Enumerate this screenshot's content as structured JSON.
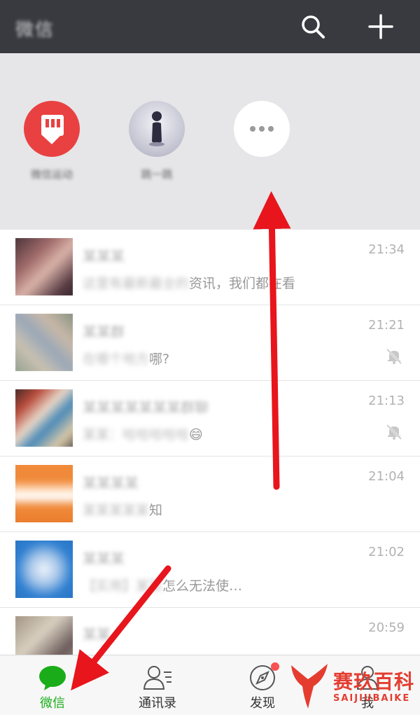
{
  "topbar": {
    "title": "微信",
    "search_icon": "search-icon",
    "add_icon": "plus-icon",
    "bg_color": "#393a3f"
  },
  "mini_programs": [
    {
      "label": "微信运动",
      "icon": "fist-app-icon",
      "color": "#e94141"
    },
    {
      "label": "跳一跳",
      "icon": "jump-game-icon"
    },
    {
      "label": "",
      "icon": "more-icon"
    }
  ],
  "chats": [
    {
      "name": "某某某",
      "preview_hidden": "这里有最新最全的",
      "preview_visible": "资讯，我们都在看",
      "time": "21:34",
      "muted": false
    },
    {
      "name": "某某群",
      "preview_hidden": "在哪个地方",
      "preview_visible": "哪?",
      "time": "21:21",
      "muted": true
    },
    {
      "name": "某某某某某某某群聊",
      "preview_hidden": "某某：哈哈哈哈哈",
      "preview_visible": "😄",
      "time": "21:13",
      "muted": true
    },
    {
      "name": "某某某某",
      "preview_hidden": "某某某某某",
      "preview_visible": "知",
      "time": "21:04",
      "muted": false
    },
    {
      "name": "某某某",
      "preview_hidden": "【实用】某某",
      "preview_visible": "怎么无法使…",
      "time": "21:02",
      "muted": false
    },
    {
      "name": "某某",
      "preview_hidden": "",
      "preview_visible": "",
      "time": "20:59",
      "muted": true
    }
  ],
  "tabs": [
    {
      "label": "微信",
      "active": true,
      "accent": "#1aad19"
    },
    {
      "label": "通讯录",
      "active": false
    },
    {
      "label": "发现",
      "active": false,
      "badge": true
    },
    {
      "label": "我",
      "active": false
    }
  ],
  "watermark": {
    "brand": "赛玖百科",
    "sub": "SAIJIUBAIKE"
  },
  "annotation_color": "#e8151c"
}
